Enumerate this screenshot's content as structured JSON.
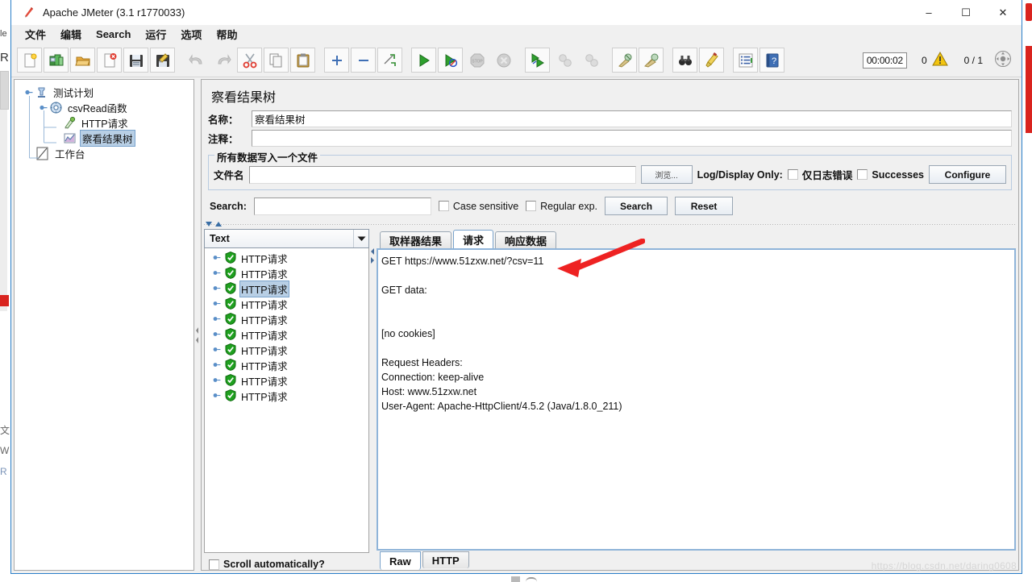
{
  "window": {
    "title": "Apache JMeter (3.1 r1770033)",
    "app_icon": "jmeter-feather-icon",
    "minimize": "–",
    "maximize": "☐",
    "close": "✕"
  },
  "menubar": {
    "items": [
      {
        "label": "文件",
        "name": "menu-file"
      },
      {
        "label": "编辑",
        "name": "menu-edit"
      },
      {
        "label": "Search",
        "name": "menu-search"
      },
      {
        "label": "运行",
        "name": "menu-run"
      },
      {
        "label": "选项",
        "name": "menu-options"
      },
      {
        "label": "帮助",
        "name": "menu-help"
      }
    ]
  },
  "toolbar": {
    "buttons": [
      {
        "name": "new-icon",
        "group": 1
      },
      {
        "name": "templates-icon",
        "group": 1
      },
      {
        "name": "open-icon",
        "group": 1
      },
      {
        "name": "close-icon",
        "group": 1
      },
      {
        "name": "save-icon",
        "group": 1
      },
      {
        "name": "save-as-icon",
        "group": 1
      },
      {
        "name": "undo-icon",
        "group": 2,
        "disabled": true
      },
      {
        "name": "redo-icon",
        "group": 2,
        "disabled": true
      },
      {
        "name": "cut-icon",
        "group": 2
      },
      {
        "name": "copy-icon",
        "group": 2
      },
      {
        "name": "paste-icon",
        "group": 2
      },
      {
        "name": "expand-all-icon",
        "group": 3
      },
      {
        "name": "collapse-all-icon",
        "group": 3
      },
      {
        "name": "toggle-icon",
        "group": 3
      },
      {
        "name": "start-icon",
        "group": 4
      },
      {
        "name": "start-no-pauses-icon",
        "group": 4
      },
      {
        "name": "stop-icon",
        "group": 4,
        "disabled": true
      },
      {
        "name": "shutdown-icon",
        "group": 4,
        "disabled": true
      },
      {
        "name": "start-remote-all-icon",
        "group": 5
      },
      {
        "name": "stop-remote-all-icon",
        "group": 5,
        "disabled": true
      },
      {
        "name": "shutdown-remote-all-icon",
        "group": 5,
        "disabled": true
      },
      {
        "name": "clear-icon",
        "group": 6
      },
      {
        "name": "clear-all-icon",
        "group": 6
      },
      {
        "name": "search-binoculars-icon",
        "group": 7
      },
      {
        "name": "reset-search-icon",
        "group": 7
      },
      {
        "name": "function-helper-icon",
        "group": 8
      },
      {
        "name": "help-icon",
        "group": 8
      }
    ],
    "status": {
      "elapsed_time": "00:00:02",
      "warning_count": "0",
      "warning_icon": "warning-triangle-icon",
      "threads": "0 / 1",
      "stop_icon": "stop-threads-icon"
    }
  },
  "tree": {
    "nodes": [
      {
        "label": "测试计划",
        "name": "tree-node-test-plan",
        "icon": "test-plan-icon",
        "depth": 0,
        "selected": false,
        "expanded": true
      },
      {
        "label": "csvRead函数",
        "name": "tree-node-thread-group",
        "icon": "thread-group-icon",
        "depth": 1,
        "selected": false,
        "expanded": true
      },
      {
        "label": "HTTP请求",
        "name": "tree-node-http-request",
        "icon": "http-sampler-icon",
        "depth": 2,
        "selected": false,
        "expanded": false
      },
      {
        "label": "察看结果树",
        "name": "tree-node-view-results-tree",
        "icon": "view-results-tree-icon",
        "depth": 2,
        "selected": true,
        "expanded": false
      },
      {
        "label": "工作台",
        "name": "tree-node-workbench",
        "icon": "workbench-icon",
        "depth": 0,
        "selected": false,
        "expanded": false
      }
    ]
  },
  "panel": {
    "title": "察看结果树",
    "name_label": "名称：",
    "name_value": "察看结果树",
    "comment_label": "注释：",
    "comment_value": "",
    "filegroup": {
      "title": "所有数据写入一个文件",
      "filename_label": "文件名",
      "filename_value": "",
      "filename_placeholder": "",
      "browse_label": "浏览...",
      "logdisplay_label": "Log/Display Only:",
      "errors_only_label": "仅日志错误",
      "errors_only_checked": false,
      "successes_label": "Successes",
      "successes_checked": false,
      "configure_label": "Configure"
    },
    "search": {
      "label": "Search:",
      "value": "",
      "placeholder": "",
      "case_sensitive_label": "Case sensitive",
      "case_sensitive_checked": false,
      "regex_label": "Regular exp.",
      "regex_checked": false,
      "search_button": "Search",
      "reset_button": "Reset"
    }
  },
  "results": {
    "renderer_selected": "Text",
    "renderer_options": [
      "Text"
    ],
    "items": [
      {
        "label": "HTTP请求",
        "status": "success",
        "selected": false
      },
      {
        "label": "HTTP请求",
        "status": "success",
        "selected": false
      },
      {
        "label": "HTTP请求",
        "status": "success",
        "selected": true
      },
      {
        "label": "HTTP请求",
        "status": "success",
        "selected": false
      },
      {
        "label": "HTTP请求",
        "status": "success",
        "selected": false
      },
      {
        "label": "HTTP请求",
        "status": "success",
        "selected": false
      },
      {
        "label": "HTTP请求",
        "status": "success",
        "selected": false
      },
      {
        "label": "HTTP请求",
        "status": "success",
        "selected": false
      },
      {
        "label": "HTTP请求",
        "status": "success",
        "selected": false
      },
      {
        "label": "HTTP请求",
        "status": "success",
        "selected": false
      }
    ],
    "scroll_automatically_label": "Scroll automatically?",
    "scroll_automatically_checked": false
  },
  "detail": {
    "tabs": [
      {
        "label": "取样器结果",
        "name": "tab-sampler-result",
        "active": false
      },
      {
        "label": "请求",
        "name": "tab-request",
        "active": true
      },
      {
        "label": "响应数据",
        "name": "tab-response-data",
        "active": false
      }
    ],
    "request_text": "GET https://www.51zxw.net/?csv=11\n\nGET data:\n\n\n[no cookies]\n\nRequest Headers:\nConnection: keep-alive\nHost: www.51zxw.net\nUser-Agent: Apache-HttpClient/4.5.2 (Java/1.8.0_211)",
    "bottom_tabs": [
      {
        "label": "Raw",
        "name": "tab-raw",
        "active": true
      },
      {
        "label": "HTTP",
        "name": "tab-http",
        "active": false
      }
    ]
  },
  "annotation": {
    "arrow_color": "#ee2222",
    "arrow_target": "GET https://www.51zxw.net/?csv=11"
  },
  "watermark": "https://blog.csdn.net/daring0608",
  "background": {
    "left_fragments": [
      "le",
      "R",
      "文",
      "W",
      "R"
    ],
    "accent_red": "#d9241f"
  }
}
